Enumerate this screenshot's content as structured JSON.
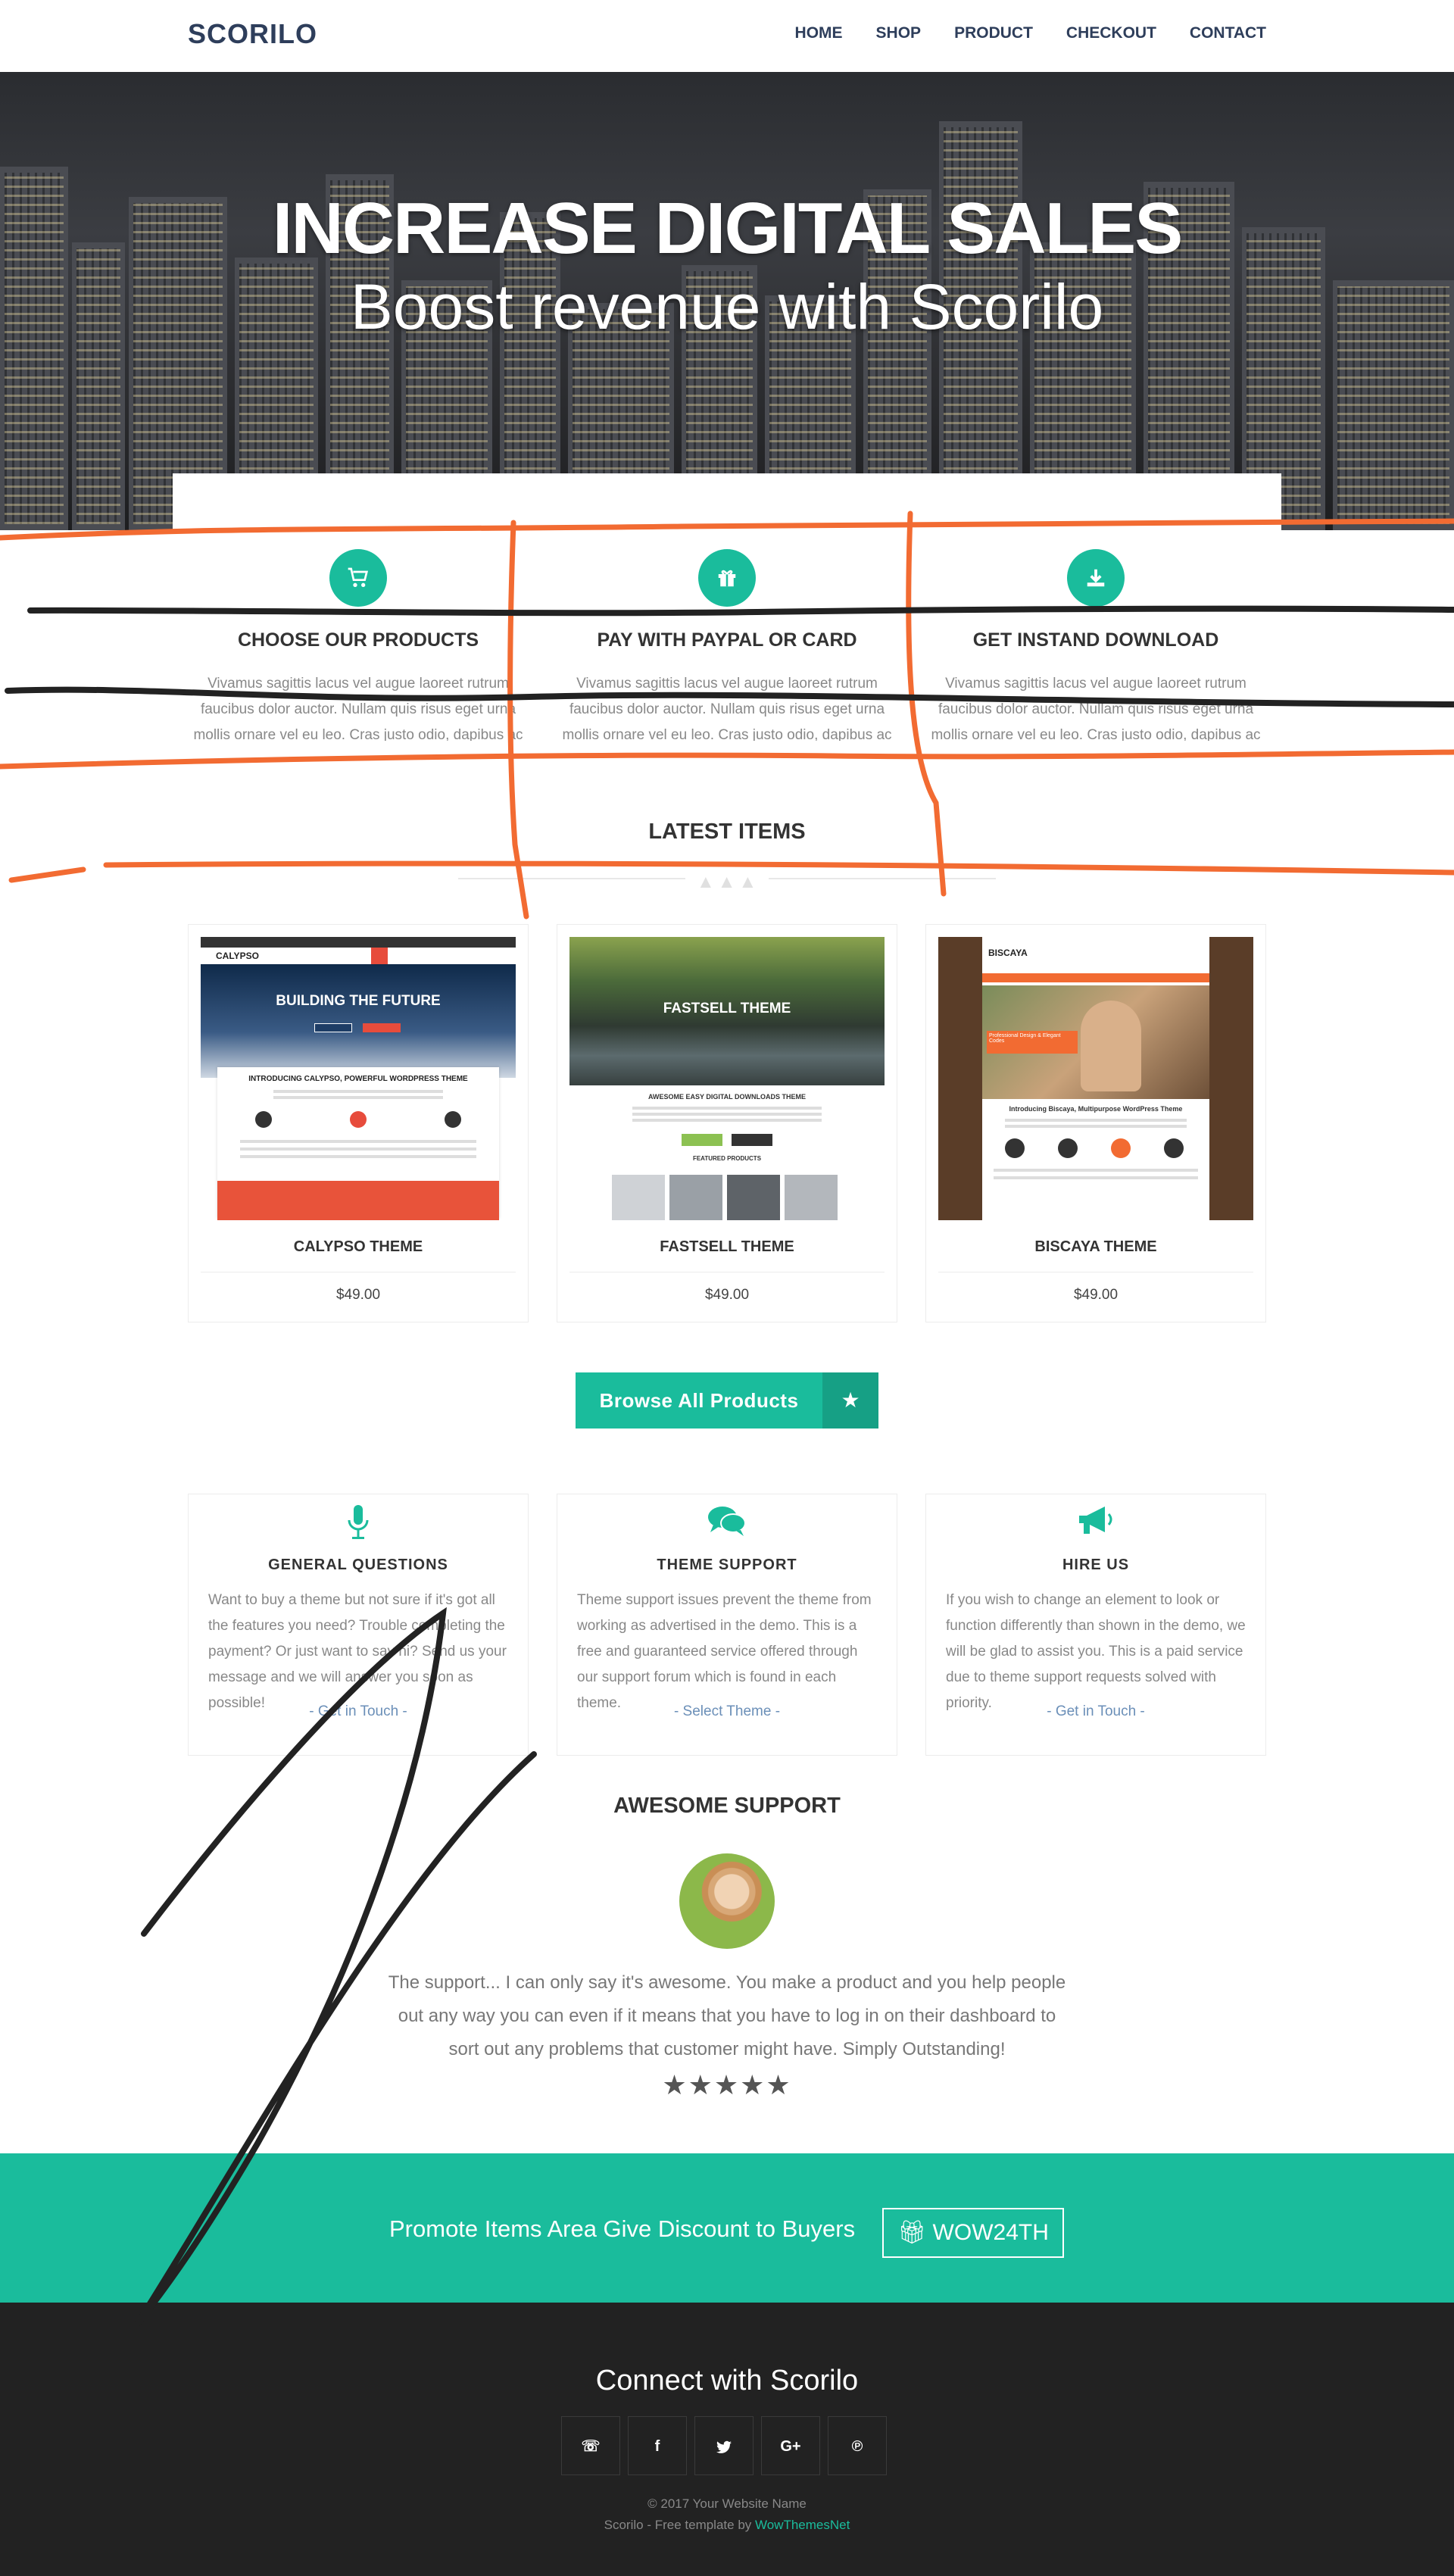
{
  "navbar": {
    "brand": "SCORILO",
    "links": [
      "HOME",
      "SHOP",
      "PRODUCT",
      "CHECKOUT",
      "CONTACT"
    ]
  },
  "hero": {
    "title": "INCREASE DIGITAL SALES",
    "subtitle": "Boost revenue with Scorilo"
  },
  "steps": [
    {
      "icon": "cart-icon",
      "title": "CHOOSE OUR PRODUCTS",
      "text": "Vivamus sagittis lacus vel augue laoreet rutrum faucibus dolor auctor. Nullam quis risus eget urna mollis ornare vel eu leo. Cras justo odio, dapibus ac facilisis in, egestas eget quam."
    },
    {
      "icon": "gift-icon",
      "title": "PAY WITH PAYPAL OR CARD",
      "text": "Vivamus sagittis lacus vel augue laoreet rutrum faucibus dolor auctor. Nullam quis risus eget urna mollis ornare vel eu leo. Cras justo odio, dapibus ac facilisis in, egestas eget quam."
    },
    {
      "icon": "download-icon",
      "title": "GET INSTAND DOWNLOAD",
      "text": "Vivamus sagittis lacus vel augue laoreet rutrum faucibus dolor auctor. Nullam quis risus eget urna mollis ornare vel eu leo. Cras justo odio, dapibus ac facilisis in, egestas eget quam."
    }
  ],
  "latest": {
    "title": "LATEST ITEMS",
    "products": [
      {
        "name": "CALYPSO THEME",
        "price": "$49.00",
        "thumb_brand": "CALYPSO",
        "thumb_headline": "BUILDING THE FUTURE",
        "thumb_tagline": "INTRODUCING CALYPSO, POWERFUL WORDPRESS THEME"
      },
      {
        "name": "FASTSELL THEME",
        "price": "$49.00",
        "thumb_headline": "FASTSELL THEME",
        "thumb_tagline": "AWESOME EASY DIGITAL DOWNLOADS THEME",
        "thumb_section": "FEATURED PRODUCTS"
      },
      {
        "name": "BISCAYA THEME",
        "price": "$49.00",
        "thumb_brand": "BISCAYA",
        "thumb_headline": "Introducing Biscaya, Multipurpose WordPress Theme",
        "thumb_tagline": "Professional Design & Elegant Codes"
      }
    ],
    "browse_label": "Browse All Products"
  },
  "support": [
    {
      "icon": "microphone-icon",
      "title": "GENERAL QUESTIONS",
      "text": "Want to buy a theme but not sure if it's got all the features you need? Trouble completing the payment? Or just want to say hi? Send us your message and we will answer you soon as possible!",
      "link": "- Get in Touch -"
    },
    {
      "icon": "comments-icon",
      "title": "THEME SUPPORT",
      "text": "Theme support issues prevent the theme from working as advertised in the demo. This is a free and guaranteed service offered through our support forum which is found in each theme.",
      "link": "- Select Theme -"
    },
    {
      "icon": "megaphone-icon",
      "title": "HIRE US",
      "text": "If you wish to change an element to look or function differently than shown in the demo, we will be glad to assist you. This is a paid service due to theme support requests solved with priority.",
      "link": "- Get in Touch -"
    }
  ],
  "testimonial": {
    "title": "AWESOME SUPPORT",
    "quote": "The support... I can only say it's awesome. You make a product and you help people out any way you can even if it means that you have to log in on their dashboard to sort out any problems that customer might have. Simply Outstanding!",
    "stars": "★★★★★",
    "rating": 5
  },
  "promo": {
    "text": "Promote Items Area Give Discount to Buyers",
    "code": "WOW24TH"
  },
  "footer": {
    "heading": "Connect with Scorilo",
    "socials": [
      "phone-icon",
      "facebook-icon",
      "twitter-icon",
      "google-plus-icon",
      "pinterest-icon"
    ],
    "copyright": "© 2017 Your Website Name",
    "credit_prefix": "Scorilo - Free template by ",
    "credit_link": "WowThemesNet"
  },
  "colors": {
    "accent": "#1abc9c",
    "accent_dark": "#16a085",
    "nav_text": "#2e3e5b",
    "footer_bg": "#222222",
    "scribble_orange": "#f26b32",
    "scribble_black": "#222222"
  }
}
